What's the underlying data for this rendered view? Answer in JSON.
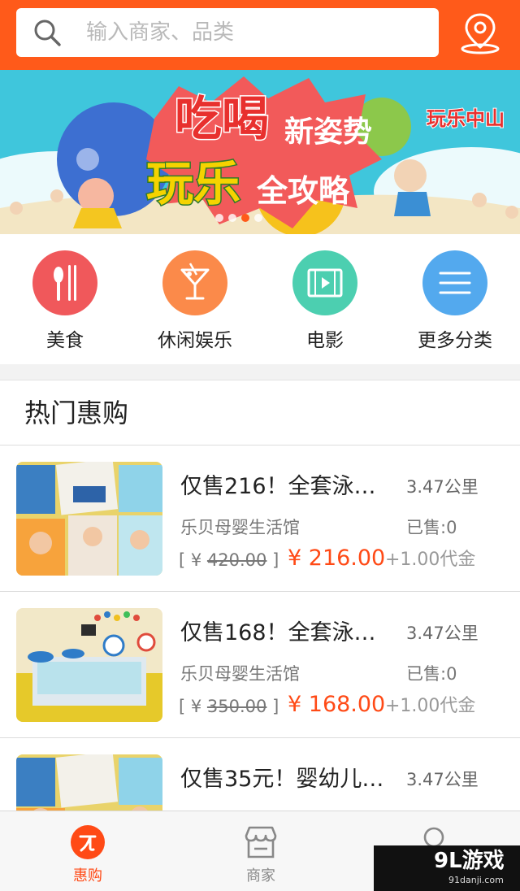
{
  "search": {
    "placeholder": "输入商家、品类"
  },
  "banner": {
    "line1": "吃喝",
    "line1b": "新姿势",
    "line2": "玩乐",
    "line2b": "全攻略",
    "brand": "玩乐中山"
  },
  "categories": [
    {
      "label": "美食",
      "icon": "fork-knife-icon",
      "color": "#f0585b"
    },
    {
      "label": "休闲娱乐",
      "icon": "cocktail-icon",
      "color": "#fb8a4a"
    },
    {
      "label": "电影",
      "icon": "film-icon",
      "color": "#4ccfb0"
    },
    {
      "label": "更多分类",
      "icon": "menu-icon",
      "color": "#53a9ee"
    }
  ],
  "section": {
    "title": "热门惠购"
  },
  "deals": [
    {
      "title": "仅售216！全套泳…",
      "distance": "3.47公里",
      "shop": "乐贝母婴生活馆",
      "sold": "已售:0",
      "orig_prefix": "[ ¥ ",
      "orig_value": "420.00",
      "orig_suffix": " ]",
      "price": "¥ 216.00",
      "coupon": "+1.00代金"
    },
    {
      "title": "仅售168！全套泳…",
      "distance": "3.47公里",
      "shop": "乐贝母婴生活馆",
      "sold": "已售:0",
      "orig_prefix": "[ ¥ ",
      "orig_value": "350.00",
      "orig_suffix": " ]",
      "price": "¥ 168.00",
      "coupon": "+1.00代金"
    },
    {
      "title": "仅售35元！婴幼儿…",
      "distance": "3.47公里"
    }
  ],
  "tabs": [
    {
      "label": "惠购",
      "active": true,
      "color": "#ff4a16"
    },
    {
      "label": "商家",
      "active": false,
      "color": "#888888"
    },
    {
      "label": "",
      "active": false
    }
  ],
  "watermark": {
    "logo": "9L游戏",
    "url": "91danji.com"
  }
}
